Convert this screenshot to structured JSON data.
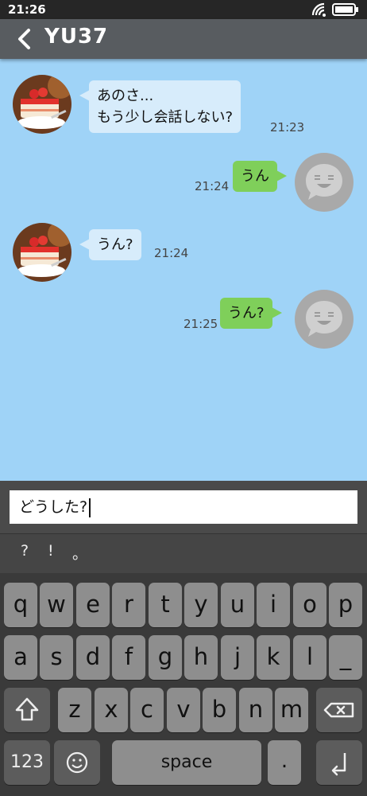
{
  "status_bar": {
    "time": "21:26"
  },
  "header": {
    "title": "YU37"
  },
  "messages": [
    {
      "side": "in",
      "lines": [
        "あのさ...",
        "もう少し会話しない?"
      ],
      "time": "21:23"
    },
    {
      "side": "out",
      "text": "うん",
      "time": "21:24"
    },
    {
      "side": "in",
      "text": "うん?",
      "time": "21:24"
    },
    {
      "side": "out",
      "text": "うん?",
      "time": "21:25"
    }
  ],
  "input": {
    "value": "どうした?"
  },
  "suggestions": [
    "?",
    "!",
    "。"
  ],
  "keyboard": {
    "row1": [
      "q",
      "w",
      "e",
      "r",
      "t",
      "y",
      "u",
      "i",
      "o",
      "p"
    ],
    "row2": [
      "a",
      "s",
      "d",
      "f",
      "g",
      "h",
      "j",
      "k",
      "l",
      "_"
    ],
    "row3": [
      "z",
      "x",
      "c",
      "v",
      "b",
      "n",
      "m"
    ],
    "numbers_label": "123",
    "space_label": "space",
    "period_label": "."
  },
  "colors": {
    "chat_bg": "#9fd3f7",
    "incoming": "#d7ecfb",
    "outgoing": "#7fcf5a",
    "header": "#585c60"
  }
}
